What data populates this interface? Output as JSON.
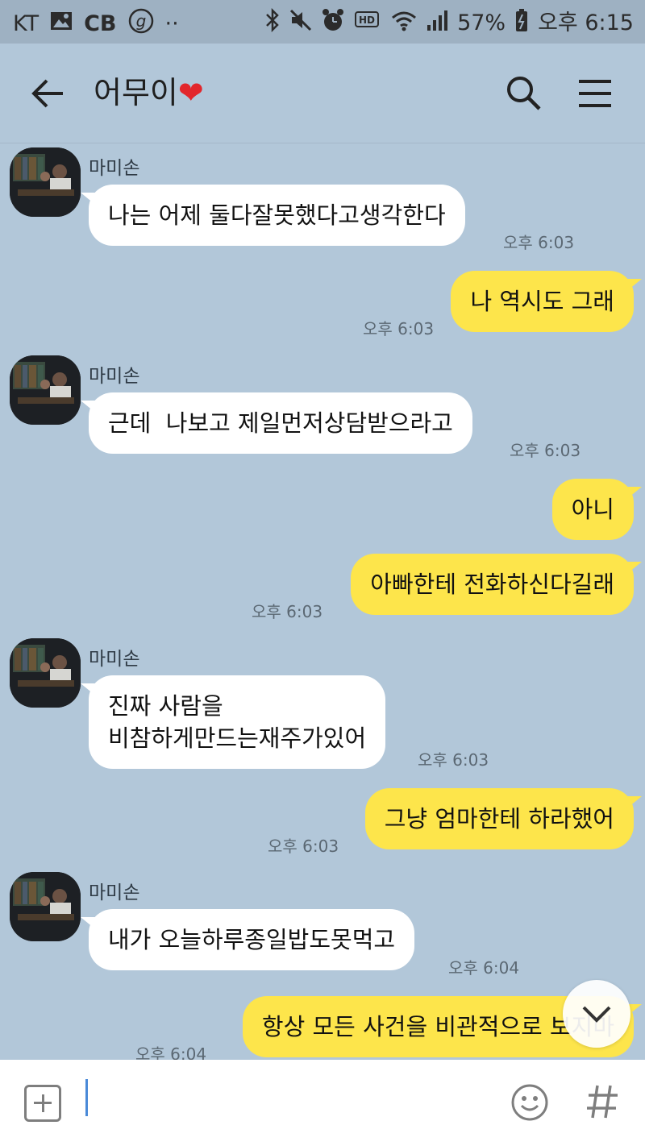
{
  "status_bar": {
    "carrier": "KT",
    "left_icons": [
      "image-icon",
      "cb-icon",
      "g-icon",
      "more-dots-icon"
    ],
    "cb_label": "CB",
    "dots": "··",
    "right_icons": [
      "bluetooth-icon",
      "mute-icon",
      "alarm-icon",
      "hd-icon",
      "wifi-icon",
      "signal-icon",
      "battery-icon"
    ],
    "hd_label": "HD",
    "battery": "57%",
    "time": "오후 6:15"
  },
  "header": {
    "title": "어무이",
    "title_emoji": "❤"
  },
  "messages": [
    {
      "side": "in",
      "sender": "마미손",
      "text": "나는 어제 둘다잘못했다고생각한다",
      "time": "오후 6:03"
    },
    {
      "side": "out",
      "text": "나 역시도 그래",
      "time": "오후 6:03"
    },
    {
      "side": "in",
      "sender": "마미손",
      "text": "근데  나보고 제일먼저상담받으라고",
      "time": "오후 6:03"
    },
    {
      "side": "out",
      "text": "아니",
      "time": ""
    },
    {
      "side": "out",
      "text": "아빠한테 전화하신다길래",
      "time": "오후 6:03"
    },
    {
      "side": "in",
      "sender": "마미손",
      "text": "진짜 사람을\n비참하게만드는재주가있어",
      "time": "오후 6:03"
    },
    {
      "side": "out",
      "text": "그냥 엄마한테 하라했어",
      "time": "오후 6:03"
    },
    {
      "side": "in",
      "sender": "마미손",
      "text": "내가 오늘하루종일밥도못먹고",
      "time": "오후 6:04"
    },
    {
      "side": "out",
      "text": "항상 모든 사건을 비관적으로 보지마",
      "time": "오후 6:04"
    }
  ],
  "input": {
    "value": "",
    "placeholder": ""
  },
  "colors": {
    "chat_background": "#b2c7d9",
    "outgoing_bubble": "#fde54b",
    "incoming_bubble": "#ffffff"
  }
}
